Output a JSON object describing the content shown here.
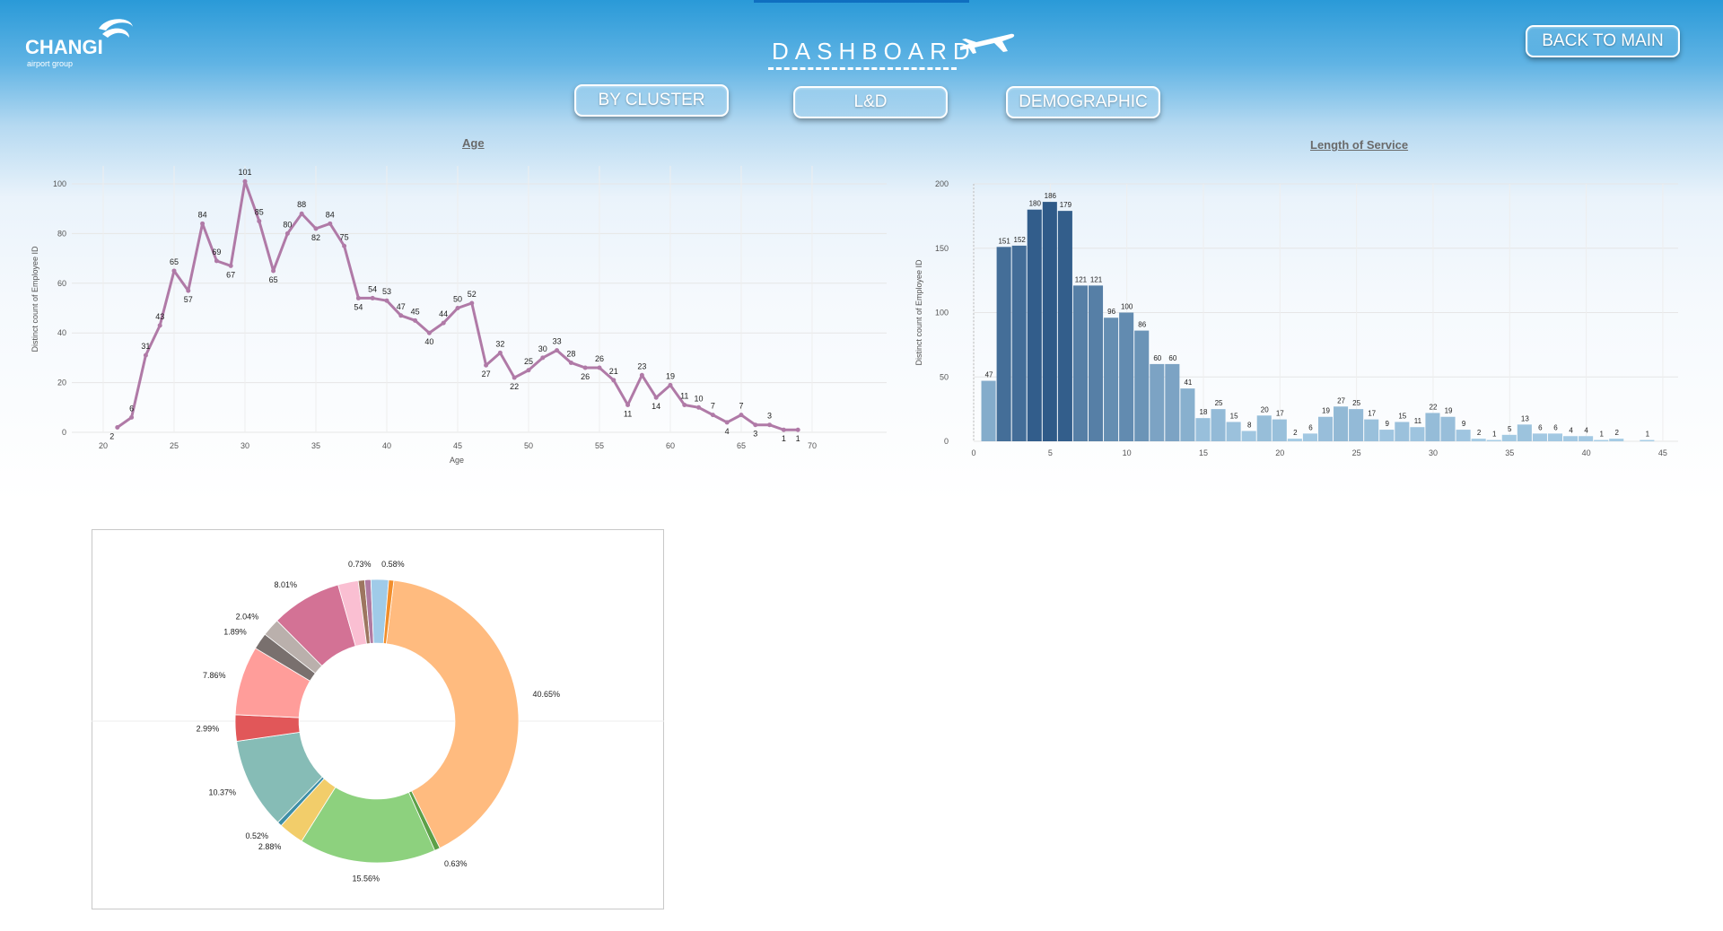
{
  "header": {
    "title": "DASHBOARD",
    "logo": {
      "brand": "CHANGI",
      "sub": "airport group"
    },
    "back_button": "BACK TO MAIN",
    "nav": [
      {
        "label": "BY CLUSTER"
      },
      {
        "label": "L&D"
      },
      {
        "label": "DEMOGRAPHIC"
      }
    ],
    "colors": {
      "accent": "#2a9ad8",
      "button_border": "#ffffff"
    }
  },
  "chart_data": [
    {
      "type": "line",
      "title": "Age",
      "xlabel": "Age",
      "ylabel": "Distinct count of Employee ID",
      "color": "#b07aa7",
      "xlim": [
        20,
        70
      ],
      "ylim": [
        0,
        100
      ],
      "xticks": [
        20,
        25,
        30,
        35,
        40,
        45,
        50,
        55,
        60,
        65,
        70
      ],
      "yticks": [
        0,
        20,
        40,
        60,
        80,
        100
      ],
      "x": [
        21,
        22,
        23,
        24,
        25,
        26,
        27,
        28,
        29,
        30,
        31,
        32,
        33,
        34,
        35,
        36,
        37,
        38,
        39,
        40,
        41,
        42,
        43,
        44,
        45,
        46,
        47,
        48,
        49,
        50,
        51,
        52,
        53,
        54,
        55,
        56,
        57,
        58,
        59,
        60,
        61,
        62,
        63,
        64,
        65,
        66,
        67,
        68,
        69
      ],
      "y": [
        2,
        6,
        31,
        43,
        65,
        57,
        84,
        69,
        67,
        101,
        85,
        65,
        80,
        88,
        82,
        84,
        75,
        54,
        54,
        53,
        47,
        45,
        40,
        44,
        50,
        52,
        27,
        32,
        22,
        25,
        30,
        33,
        28,
        26,
        26,
        21,
        11,
        23,
        14,
        19,
        11,
        10,
        7,
        4,
        7,
        3,
        3,
        1,
        1
      ]
    },
    {
      "type": "bar",
      "title": "Length of Service",
      "xlabel": "",
      "ylabel": "Distinct count of Employee ID",
      "xlim": [
        0,
        46
      ],
      "ylim": [
        0,
        200
      ],
      "xticks": [
        0,
        5,
        10,
        15,
        20,
        25,
        30,
        35,
        40,
        45
      ],
      "yticks": [
        0,
        50,
        100,
        150,
        200
      ],
      "x": [
        1,
        2,
        3,
        4,
        5,
        6,
        7,
        8,
        9,
        10,
        11,
        12,
        13,
        14,
        15,
        16,
        17,
        18,
        19,
        20,
        21,
        22,
        23,
        24,
        25,
        26,
        27,
        28,
        29,
        30,
        31,
        32,
        33,
        34,
        35,
        36,
        37,
        38,
        39,
        40,
        41,
        42,
        44
      ],
      "values": [
        47,
        151,
        152,
        180,
        186,
        179,
        121,
        121,
        96,
        100,
        86,
        60,
        60,
        41,
        18,
        25,
        15,
        8,
        20,
        17,
        2,
        6,
        19,
        27,
        25,
        17,
        9,
        15,
        11,
        22,
        19,
        9,
        2,
        1,
        5,
        13,
        6,
        6,
        4,
        4,
        1,
        2,
        1
      ],
      "color_scale": [
        "#a7cde6",
        "#2f5a88"
      ]
    },
    {
      "type": "pie",
      "hole": 0.55,
      "slices": [
        {
          "label": "40.65%",
          "value": 40.65,
          "color": "#ffbb7f"
        },
        {
          "label": "0.63%",
          "value": 0.63,
          "color": "#5da048"
        },
        {
          "label": "15.56%",
          "value": 15.56,
          "color": "#8dd17e"
        },
        {
          "label": "2.88%",
          "value": 2.88,
          "color": "#f2cd6a"
        },
        {
          "label": "0.52%",
          "value": 0.52,
          "color": "#3f8fa6"
        },
        {
          "label": "10.37%",
          "value": 10.37,
          "color": "#86bcb6"
        },
        {
          "label": "2.99%",
          "value": 2.99,
          "color": "#e15759"
        },
        {
          "label": "7.86%",
          "value": 7.86,
          "color": "#ff9d9a"
        },
        {
          "label": "1.89%",
          "value": 1.89,
          "color": "#79706e"
        },
        {
          "label": "2.04%",
          "value": 2.04,
          "color": "#bab0ac"
        },
        {
          "label": "8.01%",
          "value": 8.01,
          "color": "#d37295"
        },
        {
          "label": "",
          "value": 2.3,
          "color": "#fabfd2"
        },
        {
          "label": "0.73%",
          "value": 0.73,
          "color": "#9d7660"
        },
        {
          "label": "",
          "value": 0.7,
          "color": "#b07aa1"
        },
        {
          "label": "",
          "value": 2.0,
          "color": "#a0cbe8"
        },
        {
          "label": "0.58%",
          "value": 0.58,
          "color": "#f28e2b"
        }
      ]
    }
  ]
}
